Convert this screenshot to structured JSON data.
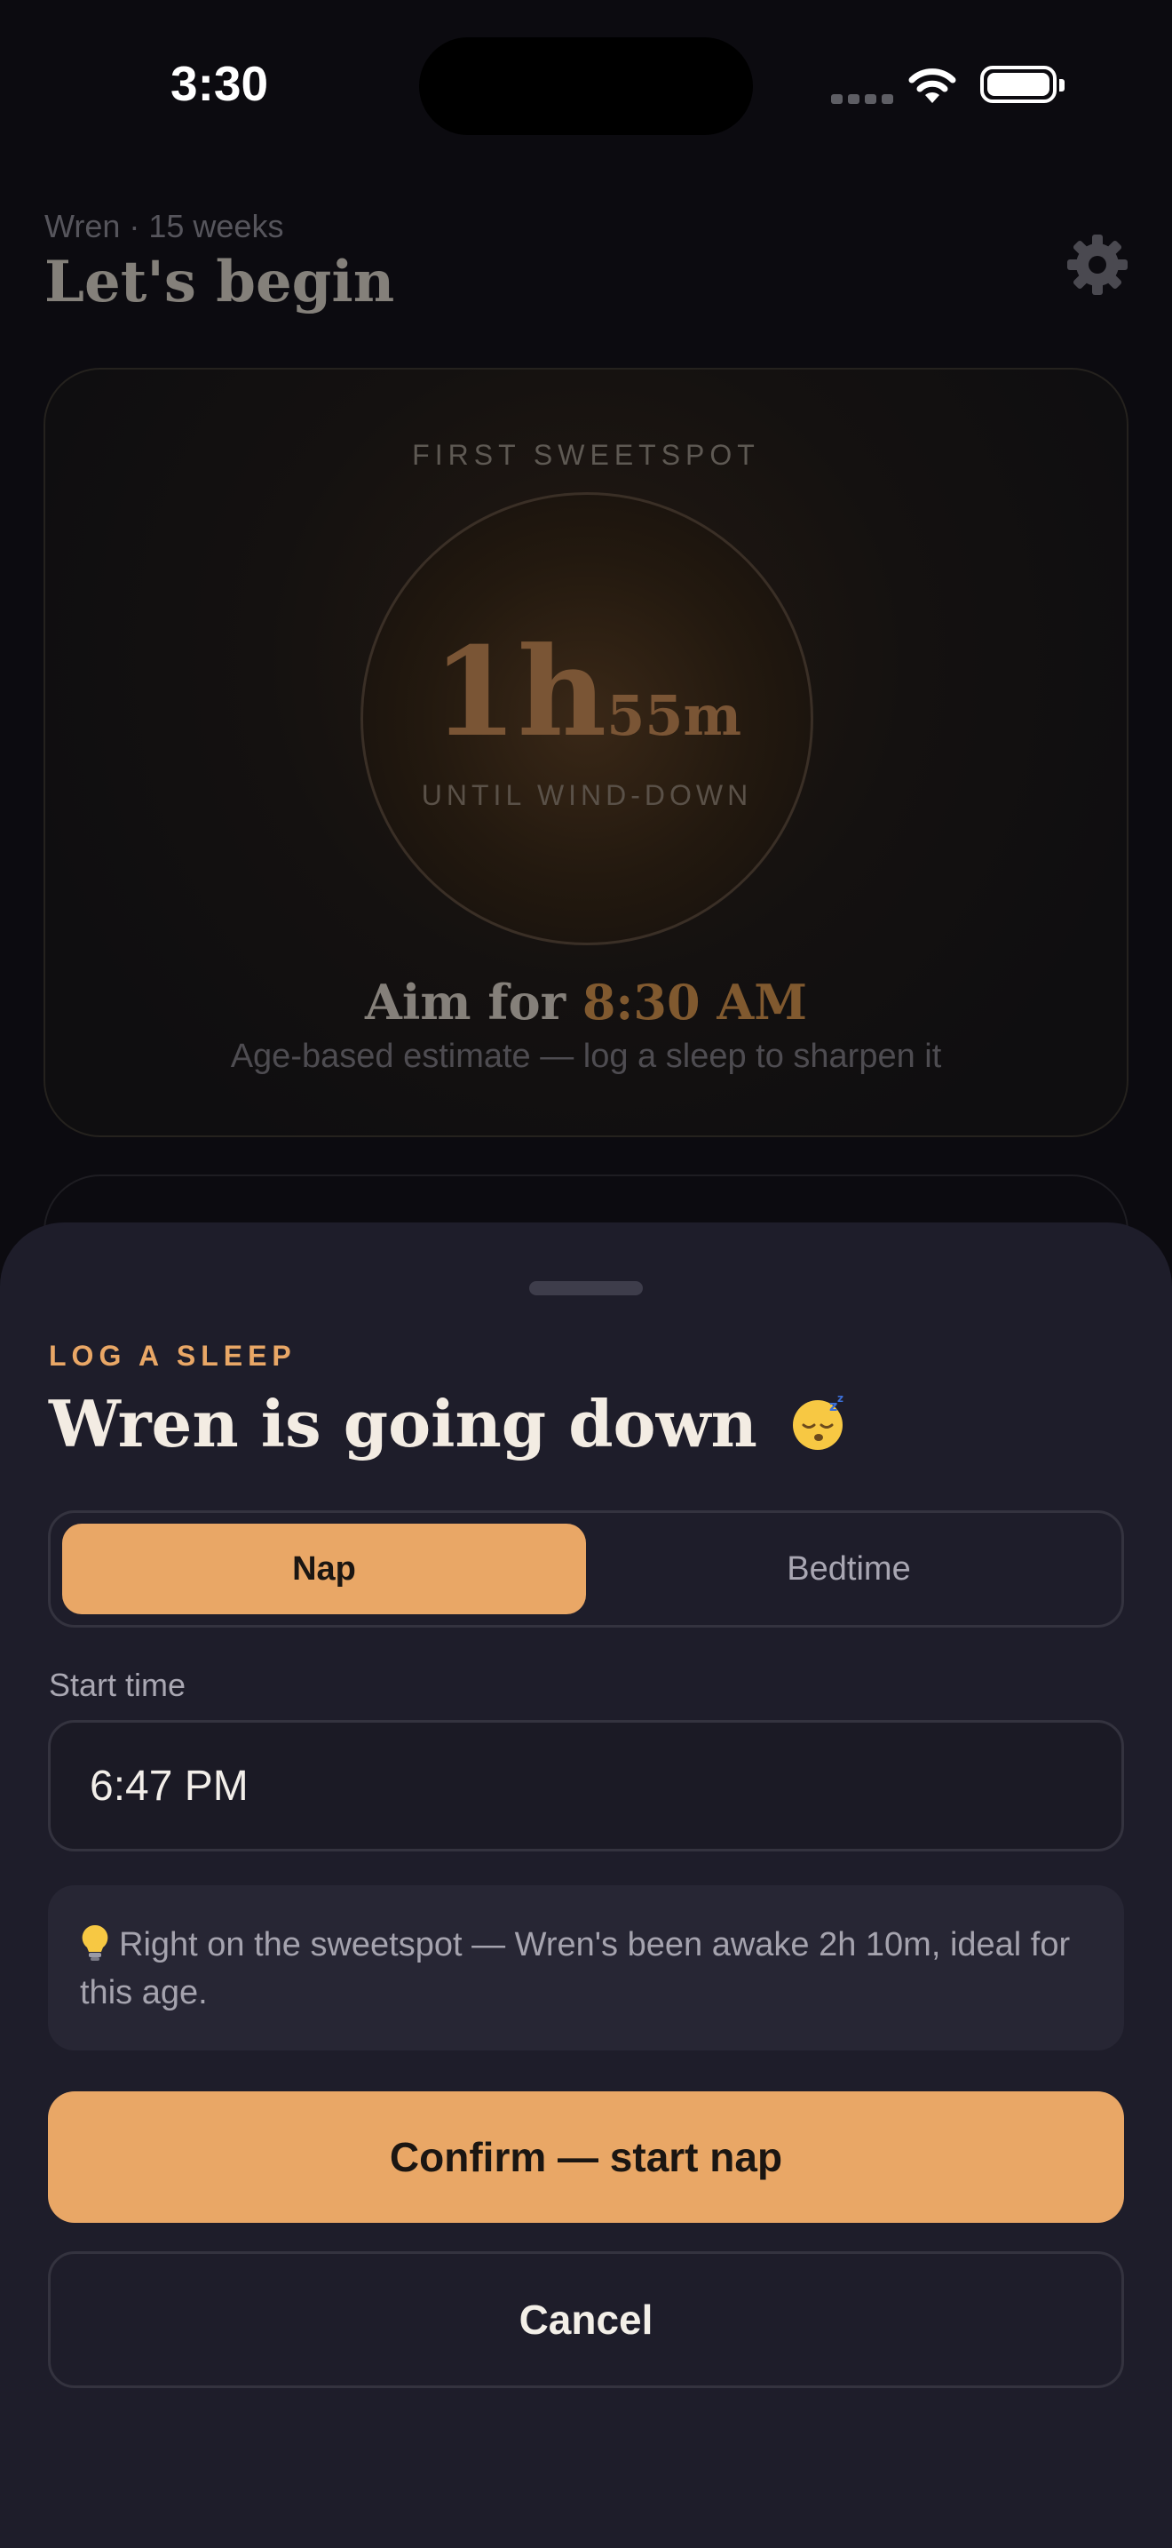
{
  "status_bar": {
    "time": "3:30"
  },
  "header": {
    "subtitle": "Wren · 15 weeks",
    "title": "Let's begin"
  },
  "sweetspot_card": {
    "eyebrow": "FIRST SWEETSPOT",
    "countdown_hours": "1h",
    "countdown_minutes": "55m",
    "ring_label": "UNTIL WIND-DOWN",
    "aim_prefix": "Aim for",
    "aim_time": "8:30 AM",
    "note": "Age-based estimate — log a sleep to sharpen it"
  },
  "sheet": {
    "eyebrow": "LOG A SLEEP",
    "title": "Wren is going down",
    "emoji_icon": "sleeping-face-icon",
    "segment": {
      "options": [
        "Nap",
        "Bedtime"
      ],
      "selected": "Nap"
    },
    "start_time_label": "Start time",
    "start_time_value": "6:47 PM",
    "hint": "Right on the sweetspot — Wren's been awake 2h 10m, ideal for this age.",
    "confirm_label": "Confirm — start nap",
    "cancel_label": "Cancel"
  },
  "colors": {
    "accent": "#e9a766",
    "sheet_bg": "#1e1d2a",
    "page_bg": "#0c0b10"
  }
}
